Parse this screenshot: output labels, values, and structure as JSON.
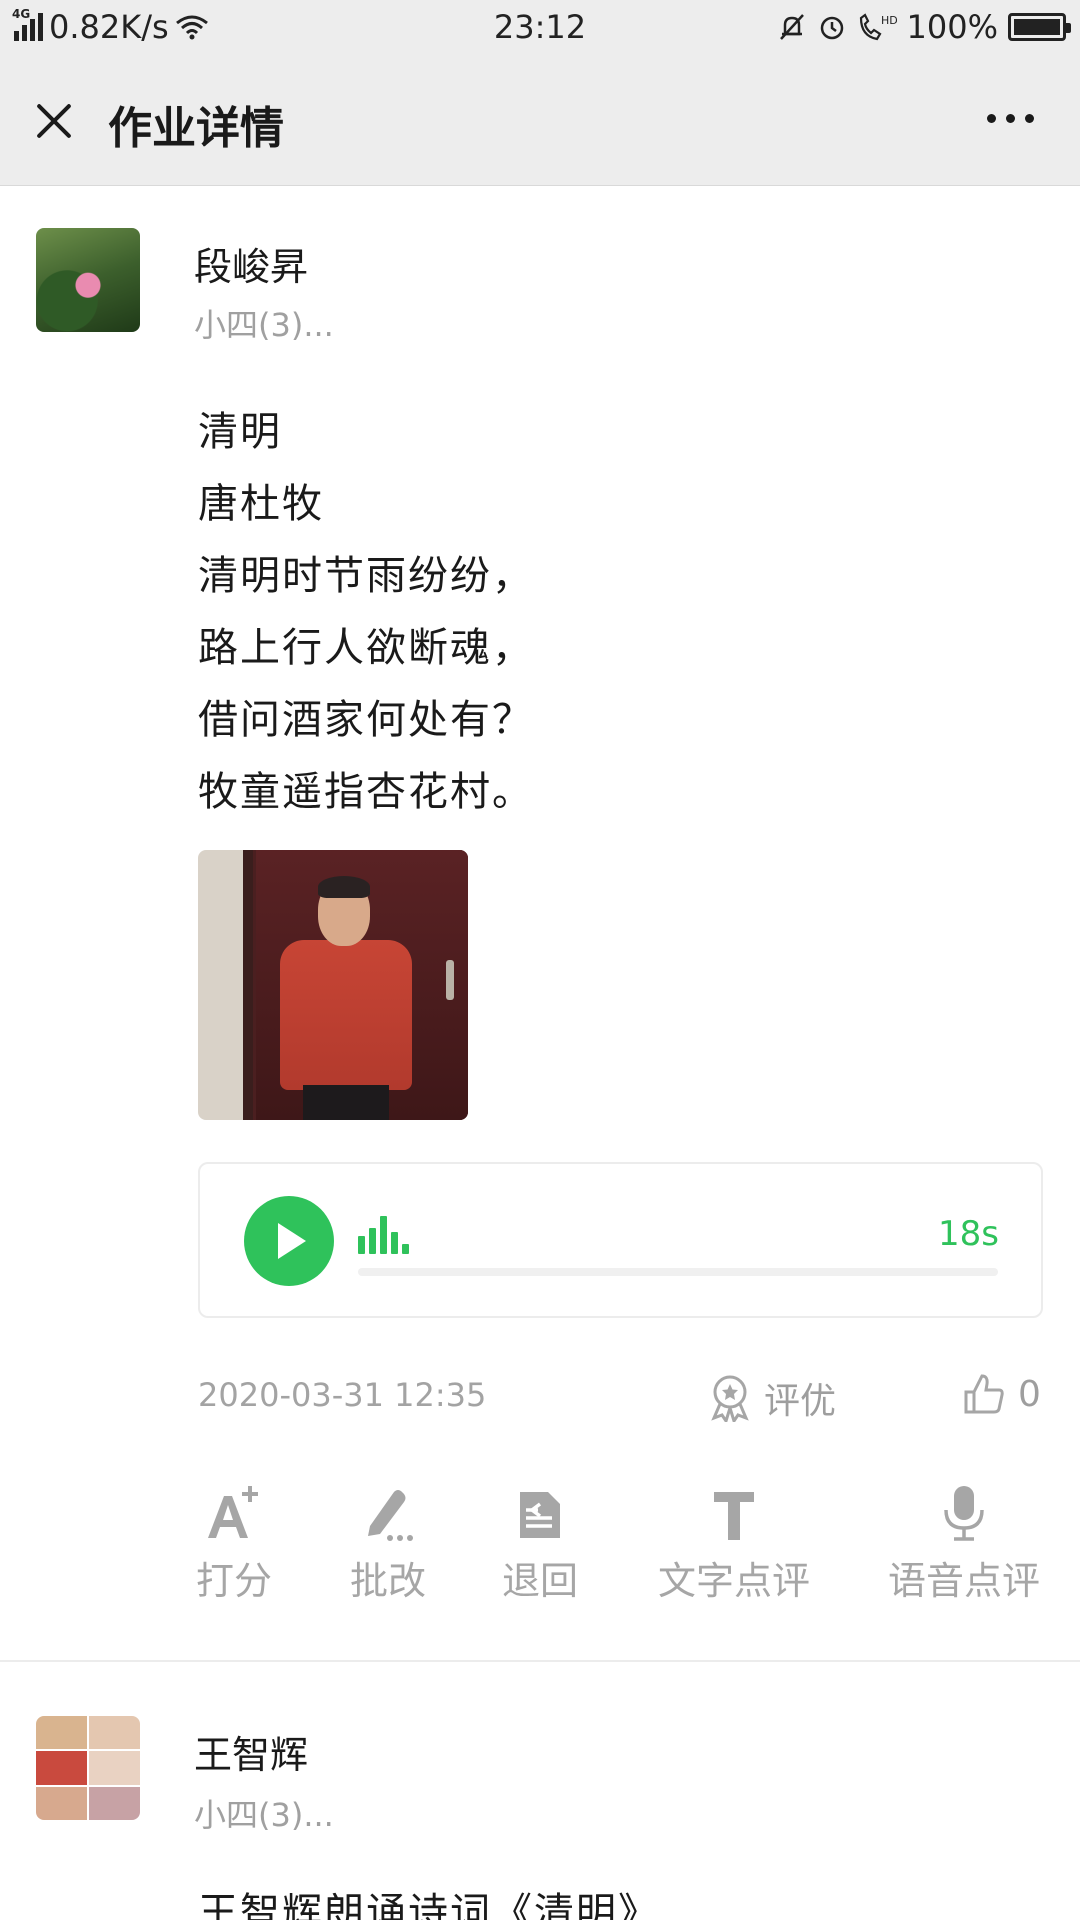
{
  "status_bar": {
    "network": "4G",
    "speed": "0.82K/s",
    "time": "23:12",
    "battery": "100%",
    "icons": [
      "signal-icon",
      "wifi-icon",
      "mute-bell-icon",
      "alarm-icon",
      "hd-call-icon",
      "battery-icon"
    ]
  },
  "header": {
    "title": "作业详情"
  },
  "posts": [
    {
      "user_name": "段峻昇",
      "class_name": "小四(3)...",
      "content_lines": [
        "清明",
        "唐杜牧",
        "清明时节雨纷纷，",
        "路上行人欲断魂，",
        "借问酒家何处有？",
        "牧童遥指杏花村。"
      ],
      "audio": {
        "duration": "18s",
        "progress_fraction": 0.0
      },
      "timestamp": "2020-03-31 12:35",
      "award_label": "评优",
      "like_count": "0",
      "actions": [
        {
          "label": "打分",
          "icon": "score-icon"
        },
        {
          "label": "批改",
          "icon": "pen-icon"
        },
        {
          "label": "退回",
          "icon": "return-icon"
        },
        {
          "label": "文字点评",
          "icon": "text-comment-icon"
        },
        {
          "label": "语音点评",
          "icon": "microphone-icon"
        }
      ]
    },
    {
      "user_name": "王智辉",
      "class_name": "小四(3)...",
      "content_preview": "王智辉朗诵诗词《清明》"
    }
  ],
  "colors": {
    "accent_green": "#2fc25b",
    "header_bg": "#ededed",
    "muted_text": "#a3a3a3"
  }
}
